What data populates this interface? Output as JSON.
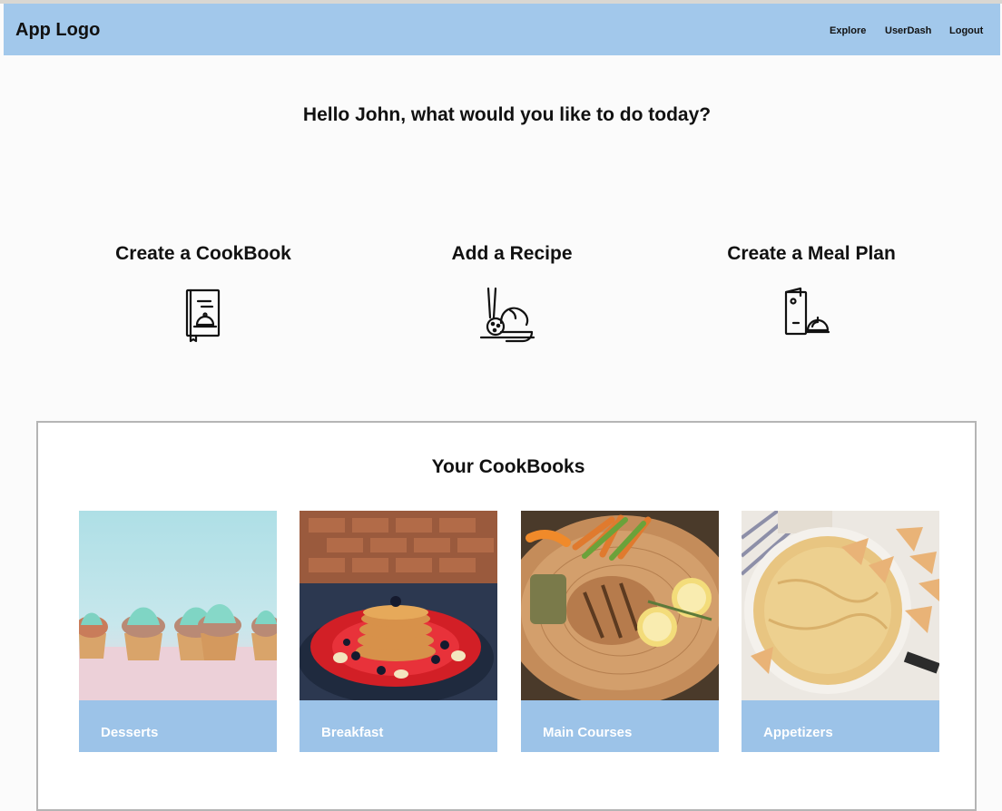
{
  "header": {
    "logo": "App Logo",
    "nav": [
      "Explore",
      "UserDash",
      "Logout"
    ]
  },
  "greeting": "Hello John, what would you like to do today?",
  "actions": [
    {
      "title": "Create a CookBook",
      "icon": "cookbook-icon"
    },
    {
      "title": "Add a Recipe",
      "icon": "recipe-bowl-icon"
    },
    {
      "title": "Create a Meal Plan",
      "icon": "meal-plan-icon"
    }
  ],
  "cookbooks": {
    "title": "Your CookBooks",
    "items": [
      {
        "label": "Desserts"
      },
      {
        "label": "Breakfast"
      },
      {
        "label": "Main Courses"
      },
      {
        "label": "Appetizers"
      }
    ]
  },
  "colors": {
    "header_bg": "#a2c8eb",
    "card_label_bg": "#9cc3e8",
    "page_bg": "#fbfbfb"
  }
}
